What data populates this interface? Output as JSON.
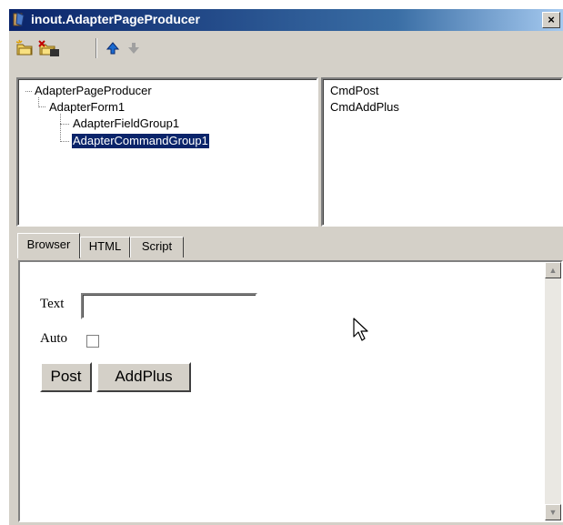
{
  "window": {
    "title": "inout.AdapterPageProducer",
    "close_label": "×"
  },
  "toolbar": {
    "buttons": [
      "new-folder-icon",
      "delete-folder-icon",
      "move-up-icon",
      "move-down-icon"
    ]
  },
  "tree": {
    "items": [
      {
        "label": "AdapterPageProducer",
        "level": 0
      },
      {
        "label": "AdapterForm1",
        "level": 1
      },
      {
        "label": "AdapterFieldGroup1",
        "level": 2
      },
      {
        "label": "AdapterCommandGroup1",
        "level": 2,
        "selected": true
      }
    ]
  },
  "commands": {
    "items": [
      "CmdPost",
      "CmdAddPlus"
    ]
  },
  "tabs": [
    {
      "label": "Browser",
      "active": true
    },
    {
      "label": "HTML",
      "active": false
    },
    {
      "label": "Script",
      "active": false
    }
  ],
  "browser": {
    "text_label": "Text",
    "text_value": "",
    "auto_label": "Auto",
    "auto_checked": false,
    "post_label": "Post",
    "addplus_label": "AddPlus"
  },
  "colors": {
    "title_bar": "#0a246a",
    "face": "#d4d0c8",
    "selection": "#0a246a"
  }
}
